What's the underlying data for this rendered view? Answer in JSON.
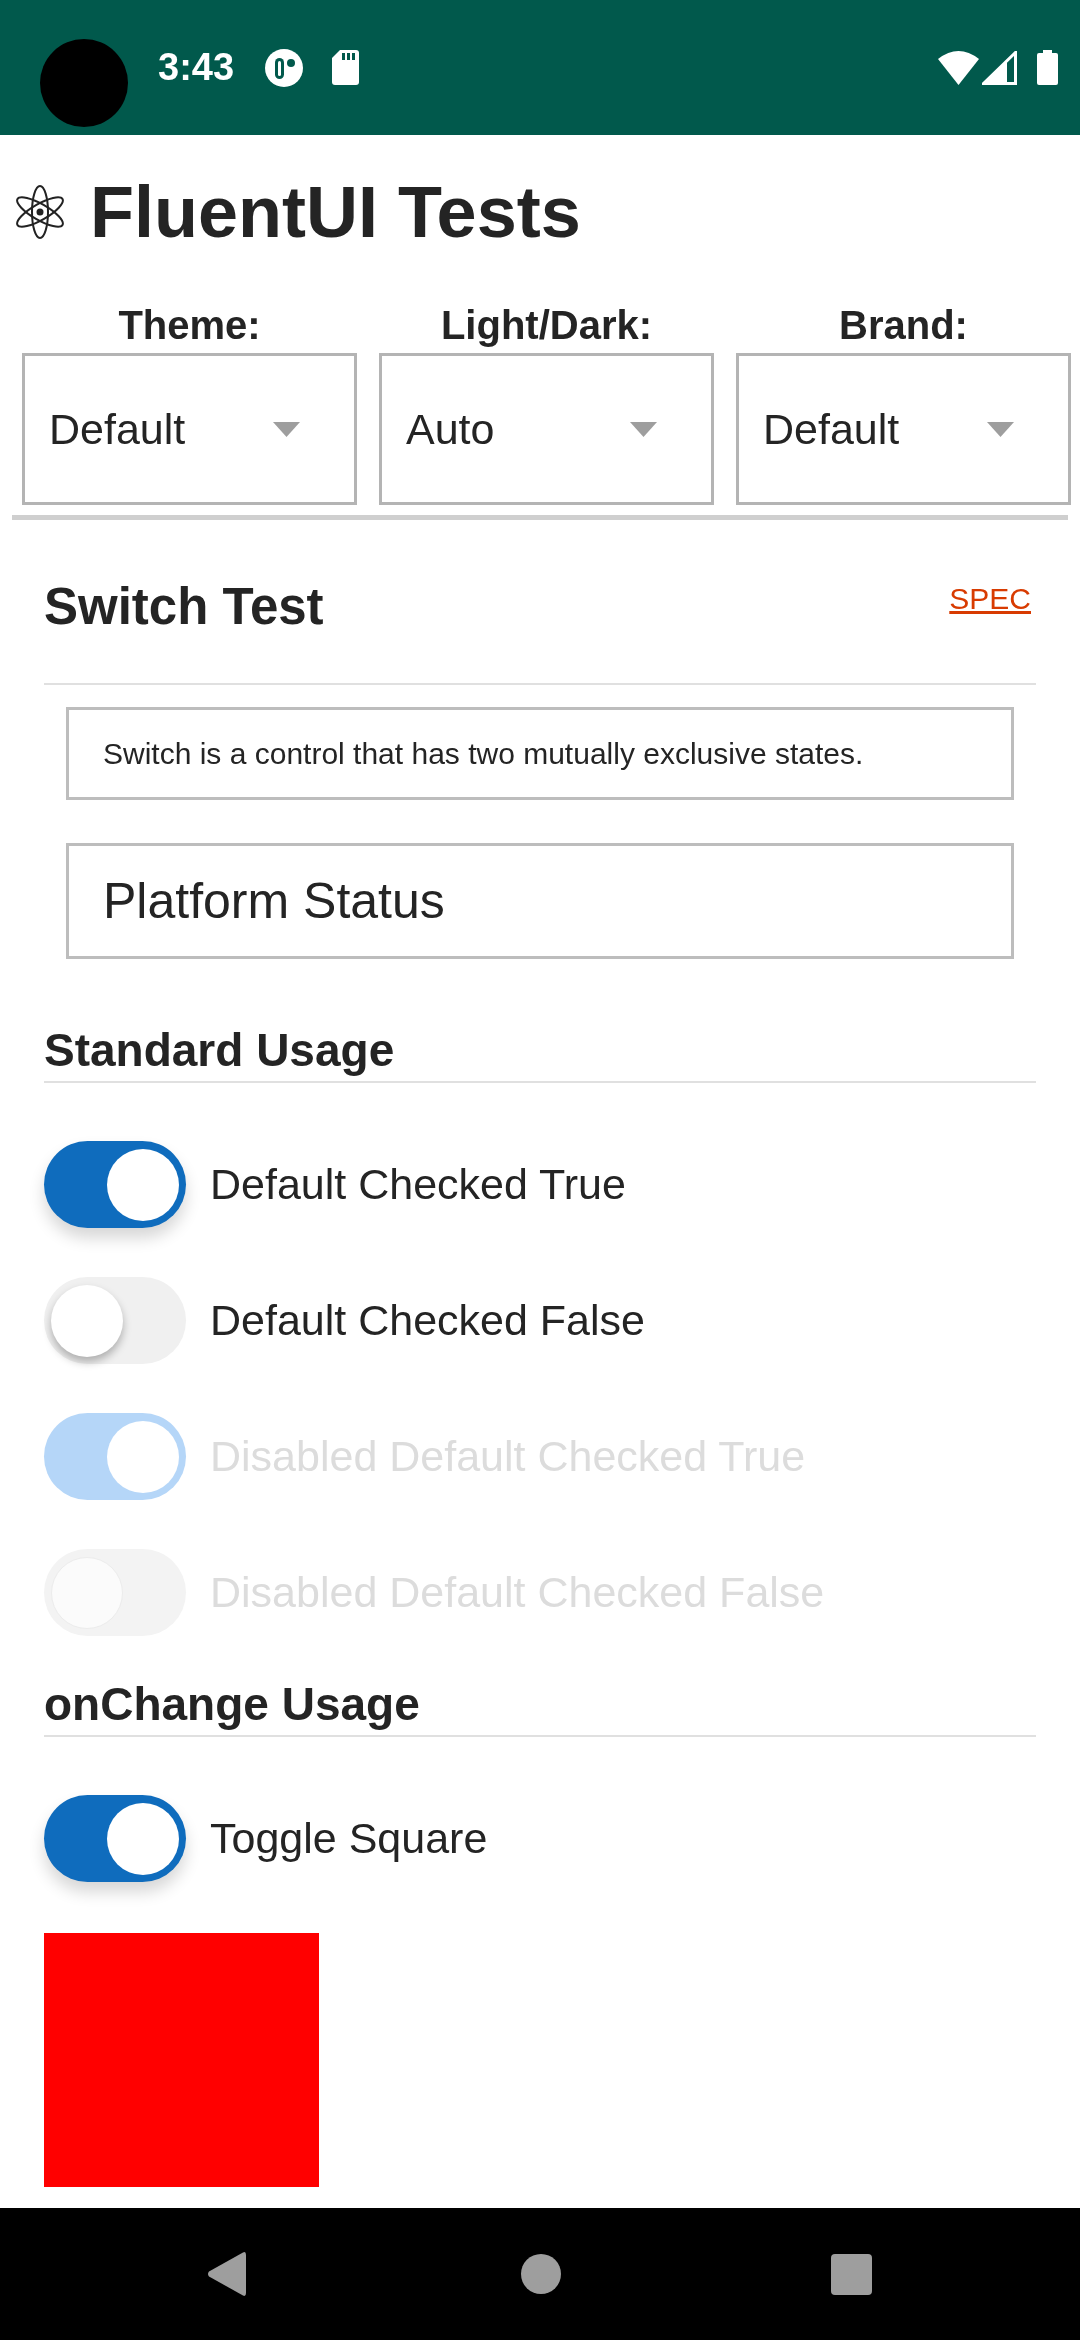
{
  "status_bar": {
    "time": "3:43"
  },
  "header": {
    "title": "FluentUI Tests"
  },
  "pickers": [
    {
      "label": "Theme:",
      "value": "Default"
    },
    {
      "label": "Light/Dark:",
      "value": "Auto"
    },
    {
      "label": "Brand:",
      "value": "Default"
    }
  ],
  "test_page": {
    "title": "Switch Test",
    "spec_link": "SPEC",
    "description": "Switch is a control that has two mutually exclusive states.",
    "platform_status": "Platform Status"
  },
  "sections": [
    {
      "heading": "Standard Usage",
      "switches": [
        {
          "label": "Default Checked True",
          "checked": true,
          "disabled": false
        },
        {
          "label": "Default Checked False",
          "checked": false,
          "disabled": false
        },
        {
          "label": "Disabled Default Checked True",
          "checked": true,
          "disabled": true
        },
        {
          "label": "Disabled Default Checked False",
          "checked": false,
          "disabled": true
        }
      ]
    },
    {
      "heading": "onChange Usage",
      "switches": [
        {
          "label": "Toggle Square",
          "checked": true,
          "disabled": false
        }
      ]
    }
  ]
}
